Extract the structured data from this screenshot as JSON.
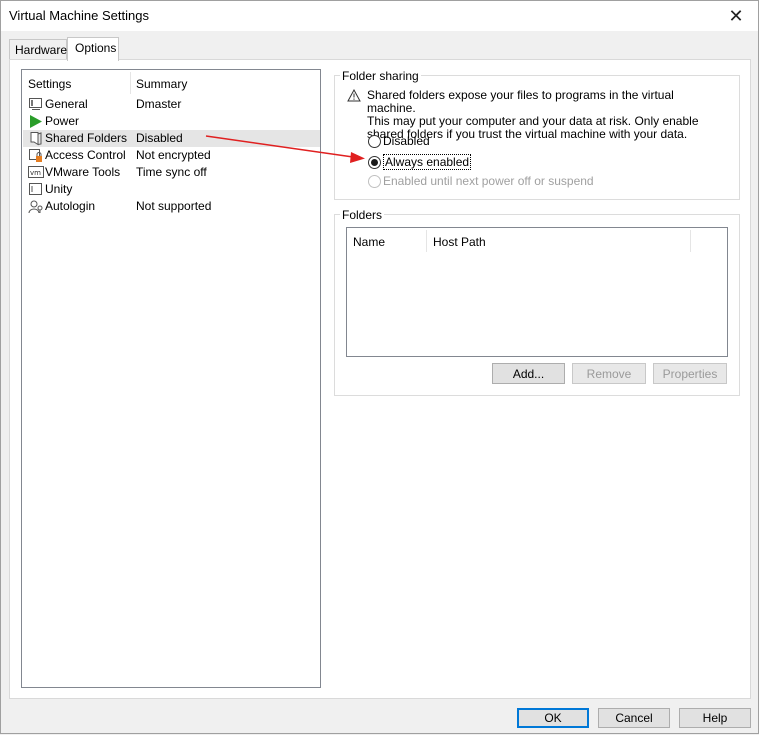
{
  "window": {
    "title": "Virtual Machine Settings",
    "close_glyph": "✕"
  },
  "tabs": [
    {
      "label": "Hardware",
      "active": false
    },
    {
      "label": "Options",
      "active": true
    }
  ],
  "settings_list": {
    "headers": {
      "settings": "Settings",
      "summary": "Summary"
    },
    "items": [
      {
        "name": "General",
        "summary": "Dmaster",
        "icon": "general-icon",
        "selected": false
      },
      {
        "name": "Power",
        "summary": "",
        "icon": "power-icon",
        "selected": false
      },
      {
        "name": "Shared Folders",
        "summary": "Disabled",
        "icon": "shared-folders-icon",
        "selected": true
      },
      {
        "name": "Access Control",
        "summary": "Not encrypted",
        "icon": "access-control-icon",
        "selected": false
      },
      {
        "name": "VMware Tools",
        "summary": "Time sync off",
        "icon": "vmware-tools-icon",
        "selected": false
      },
      {
        "name": "Unity",
        "summary": "",
        "icon": "unity-icon",
        "selected": false
      },
      {
        "name": "Autologin",
        "summary": "Not supported",
        "icon": "autologin-icon",
        "selected": false
      }
    ]
  },
  "folder_sharing": {
    "label": "Folder sharing",
    "warning_lines": [
      "Shared folders expose your files to programs in the virtual machine.",
      "This may put your computer and your data at risk. Only enable",
      "shared folders if you trust the virtual machine with your data."
    ],
    "options": [
      {
        "label": "Disabled",
        "checked": false,
        "enabled": true
      },
      {
        "label": "Always enabled",
        "checked": true,
        "enabled": true
      },
      {
        "label": "Enabled until next power off or suspend",
        "checked": false,
        "enabled": false
      }
    ]
  },
  "folders": {
    "label": "Folders",
    "columns": [
      "Name",
      "Host Path"
    ],
    "rows": [],
    "buttons": {
      "add": "Add...",
      "remove": "Remove",
      "properties": "Properties"
    }
  },
  "footer": {
    "ok": "OK",
    "cancel": "Cancel",
    "help": "Help"
  },
  "colors": {
    "annotation_arrow": "#e02020",
    "selection": "#e5e5e5",
    "default_button_border": "#0078d7",
    "power_icon": "#2a9d2a"
  }
}
